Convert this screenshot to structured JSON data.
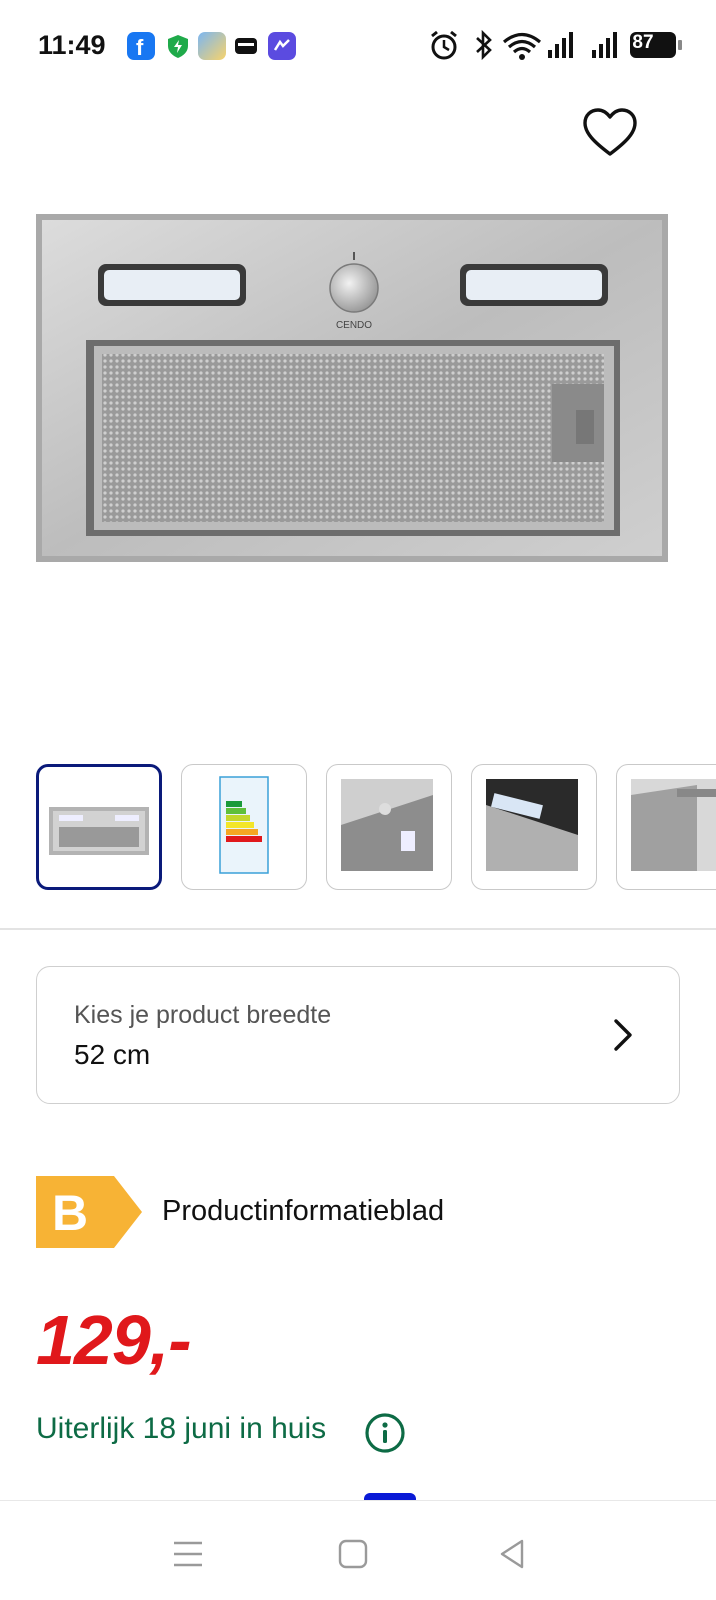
{
  "status_bar": {
    "time": "11:49",
    "battery": "87",
    "icons": [
      "facebook-icon",
      "shield-icon",
      "weather-icon",
      "wallet-icon",
      "app-icon",
      "alarm-icon",
      "bluetooth-icon",
      "wifi-icon",
      "signal-icon",
      "signal-icon",
      "battery-icon"
    ]
  },
  "product": {
    "hero_brand": "CENDO",
    "favorite_icon": "heart-icon",
    "thumbnails_count": 5
  },
  "selector": {
    "label": "Kies je product breedte",
    "value": "52 cm",
    "icon": "chevron-right-icon"
  },
  "energy": {
    "class": "B",
    "link": "Productinformatieblad",
    "color": "#f7b335"
  },
  "price": {
    "amount": "129,-",
    "color": "#e0181b"
  },
  "delivery": {
    "text": "Uiterlijk 18 juni in huis",
    "icon": "info-icon",
    "color": "#0d6b45"
  },
  "nav": {
    "icons": [
      "menu-icon",
      "home-icon",
      "back-icon"
    ]
  }
}
